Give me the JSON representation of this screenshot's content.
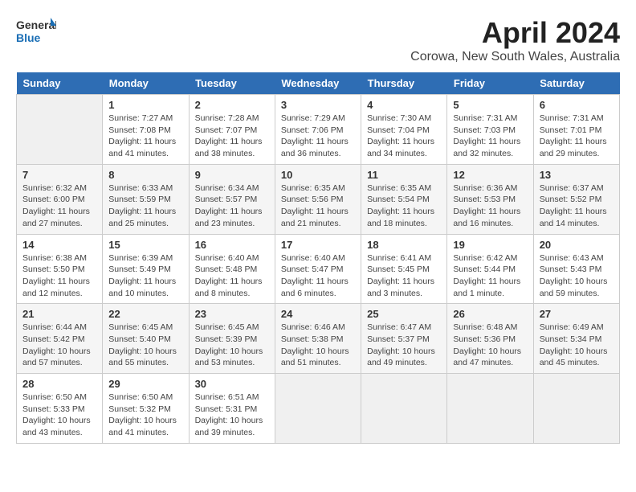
{
  "app": {
    "logo_general": "General",
    "logo_blue": "Blue"
  },
  "title": "April 2024",
  "location": "Corowa, New South Wales, Australia",
  "days_of_week": [
    "Sunday",
    "Monday",
    "Tuesday",
    "Wednesday",
    "Thursday",
    "Friday",
    "Saturday"
  ],
  "weeks": [
    [
      {
        "day": "",
        "info": ""
      },
      {
        "day": "1",
        "info": "Sunrise: 7:27 AM\nSunset: 7:08 PM\nDaylight: 11 hours\nand 41 minutes."
      },
      {
        "day": "2",
        "info": "Sunrise: 7:28 AM\nSunset: 7:07 PM\nDaylight: 11 hours\nand 38 minutes."
      },
      {
        "day": "3",
        "info": "Sunrise: 7:29 AM\nSunset: 7:06 PM\nDaylight: 11 hours\nand 36 minutes."
      },
      {
        "day": "4",
        "info": "Sunrise: 7:30 AM\nSunset: 7:04 PM\nDaylight: 11 hours\nand 34 minutes."
      },
      {
        "day": "5",
        "info": "Sunrise: 7:31 AM\nSunset: 7:03 PM\nDaylight: 11 hours\nand 32 minutes."
      },
      {
        "day": "6",
        "info": "Sunrise: 7:31 AM\nSunset: 7:01 PM\nDaylight: 11 hours\nand 29 minutes."
      }
    ],
    [
      {
        "day": "7",
        "info": "Sunrise: 6:32 AM\nSunset: 6:00 PM\nDaylight: 11 hours\nand 27 minutes."
      },
      {
        "day": "8",
        "info": "Sunrise: 6:33 AM\nSunset: 5:59 PM\nDaylight: 11 hours\nand 25 minutes."
      },
      {
        "day": "9",
        "info": "Sunrise: 6:34 AM\nSunset: 5:57 PM\nDaylight: 11 hours\nand 23 minutes."
      },
      {
        "day": "10",
        "info": "Sunrise: 6:35 AM\nSunset: 5:56 PM\nDaylight: 11 hours\nand 21 minutes."
      },
      {
        "day": "11",
        "info": "Sunrise: 6:35 AM\nSunset: 5:54 PM\nDaylight: 11 hours\nand 18 minutes."
      },
      {
        "day": "12",
        "info": "Sunrise: 6:36 AM\nSunset: 5:53 PM\nDaylight: 11 hours\nand 16 minutes."
      },
      {
        "day": "13",
        "info": "Sunrise: 6:37 AM\nSunset: 5:52 PM\nDaylight: 11 hours\nand 14 minutes."
      }
    ],
    [
      {
        "day": "14",
        "info": "Sunrise: 6:38 AM\nSunset: 5:50 PM\nDaylight: 11 hours\nand 12 minutes."
      },
      {
        "day": "15",
        "info": "Sunrise: 6:39 AM\nSunset: 5:49 PM\nDaylight: 11 hours\nand 10 minutes."
      },
      {
        "day": "16",
        "info": "Sunrise: 6:40 AM\nSunset: 5:48 PM\nDaylight: 11 hours\nand 8 minutes."
      },
      {
        "day": "17",
        "info": "Sunrise: 6:40 AM\nSunset: 5:47 PM\nDaylight: 11 hours\nand 6 minutes."
      },
      {
        "day": "18",
        "info": "Sunrise: 6:41 AM\nSunset: 5:45 PM\nDaylight: 11 hours\nand 3 minutes."
      },
      {
        "day": "19",
        "info": "Sunrise: 6:42 AM\nSunset: 5:44 PM\nDaylight: 11 hours\nand 1 minute."
      },
      {
        "day": "20",
        "info": "Sunrise: 6:43 AM\nSunset: 5:43 PM\nDaylight: 10 hours\nand 59 minutes."
      }
    ],
    [
      {
        "day": "21",
        "info": "Sunrise: 6:44 AM\nSunset: 5:42 PM\nDaylight: 10 hours\nand 57 minutes."
      },
      {
        "day": "22",
        "info": "Sunrise: 6:45 AM\nSunset: 5:40 PM\nDaylight: 10 hours\nand 55 minutes."
      },
      {
        "day": "23",
        "info": "Sunrise: 6:45 AM\nSunset: 5:39 PM\nDaylight: 10 hours\nand 53 minutes."
      },
      {
        "day": "24",
        "info": "Sunrise: 6:46 AM\nSunset: 5:38 PM\nDaylight: 10 hours\nand 51 minutes."
      },
      {
        "day": "25",
        "info": "Sunrise: 6:47 AM\nSunset: 5:37 PM\nDaylight: 10 hours\nand 49 minutes."
      },
      {
        "day": "26",
        "info": "Sunrise: 6:48 AM\nSunset: 5:36 PM\nDaylight: 10 hours\nand 47 minutes."
      },
      {
        "day": "27",
        "info": "Sunrise: 6:49 AM\nSunset: 5:34 PM\nDaylight: 10 hours\nand 45 minutes."
      }
    ],
    [
      {
        "day": "28",
        "info": "Sunrise: 6:50 AM\nSunset: 5:33 PM\nDaylight: 10 hours\nand 43 minutes."
      },
      {
        "day": "29",
        "info": "Sunrise: 6:50 AM\nSunset: 5:32 PM\nDaylight: 10 hours\nand 41 minutes."
      },
      {
        "day": "30",
        "info": "Sunrise: 6:51 AM\nSunset: 5:31 PM\nDaylight: 10 hours\nand 39 minutes."
      },
      {
        "day": "",
        "info": ""
      },
      {
        "day": "",
        "info": ""
      },
      {
        "day": "",
        "info": ""
      },
      {
        "day": "",
        "info": ""
      }
    ]
  ]
}
